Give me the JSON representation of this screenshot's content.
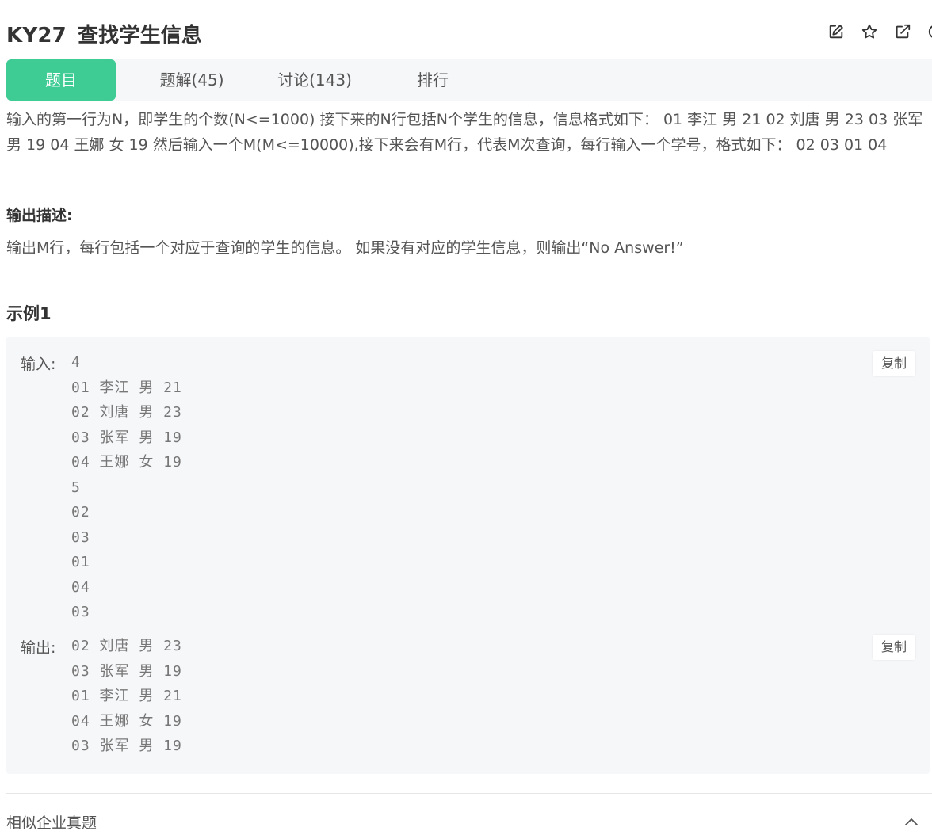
{
  "header": {
    "code": "KY27",
    "title": "查找学生信息",
    "icons": [
      "edit-icon",
      "star-icon",
      "external-link-icon",
      "info-icon"
    ]
  },
  "tabs": [
    {
      "label": "题目",
      "active": true
    },
    {
      "label": "题解(45)"
    },
    {
      "label": "讨论(143)"
    },
    {
      "label": "排行"
    }
  ],
  "problem": {
    "input_desc": "输入的第一行为N，即学生的个数(N<=1000) 接下来的N行包括N个学生的信息，信息格式如下： 01 李江 男 21 02 刘唐 男 23 03 张军 男 19 04 王娜 女 19 然后输入一个M(M<=10000),接下来会有M行，代表M次查询，每行输入一个学号，格式如下： 02 03 01 04",
    "output_heading": "输出描述:",
    "output_desc": "输出M行，每行包括一个对应于查询的学生的信息。 如果没有对应的学生信息，则输出“No Answer!”"
  },
  "example": {
    "title": "示例1",
    "input_label": "输入:",
    "input_lines": [
      "4",
      "01 李江 男 21",
      "02 刘唐 男 23",
      "03 张军 男 19",
      "04 王娜 女 19",
      "5",
      "02",
      "03",
      "01",
      "04",
      "03"
    ],
    "output_label": "输出:",
    "output_lines": [
      "02 刘唐 男 23",
      "03 张军 男 19",
      "01 李江 男 21",
      "04 王娜 女 19",
      "03 张军 男 19"
    ],
    "copy_label": "复制"
  },
  "similar": {
    "label": "相似企业真题"
  },
  "colors": {
    "accent": "#3ecc94",
    "tab_bg": "#f6f7f9",
    "code_bg": "#f6f7f9"
  }
}
